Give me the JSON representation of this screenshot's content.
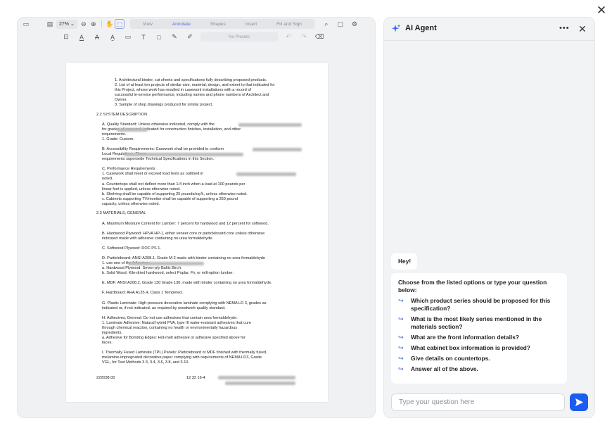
{
  "toolbar": {
    "zoom": "27%",
    "tabs": [
      "View",
      "Annotate",
      "Shapes",
      "Insert",
      "Fill and Sign"
    ],
    "active_tab": "Annotate",
    "presets_label": "No Presets"
  },
  "document": {
    "lines": [
      "1.      Architectural binder, cut sheets and specifications fully describing proposed products.",
      "2.      List of at least ten projects of similar size, material, design, and extent to that indicated for",
      "          this Project, whose work has resulted in casework installations with a record of",
      "          successful in-service performance, including names and phone numbers of Architect and",
      "          Owner.",
      "3.      Sample of shop drawings produced for similar project.",
      "2.2     SYSTEM DESCRIPTION",
      "A.      Quality Standard:  Unless otherwise indicated, comply with the",
      "          for grades of casework indicated for construction finishes, installation, and other",
      "          requirements.",
      "          1.      Grade: Custom.",
      "B.      Accessibility Requirements:  Casework shall be provided to conform",
      "                                                                              Local Regulations.  These",
      "          requirements supersede Technical Specifications in this Section.",
      "C.      Performance Requirements",
      "          1.      Casework shall meet or exceed load tests as outlined in",
      "                   noted.",
      "                   a.      Countertops shall not deflect more than 1/4 inch when a load at 100 pounds per",
      "                             linear foot is applied, unless otherwise noted.",
      "                   b.      Shelving shall be capable of supporting 25 pounds/sq.ft., unless otherwise noted.",
      "                   c.      Cabinets supporting TV/monitor shall be capable of supporting a 250 pound",
      "                             capacity, unless otherwise noted.",
      "2.3     MATERIALS, GENERAL",
      "A.      Maximum Moisture Content for Lumber:  7 percent for hardwood and 12 percent for softwood.",
      "B.      Hardwood Plywood:   HPVA HP-1, either veneer core or particleboard core unless otherwise",
      "          indicated made with adhesive containing no urea formaldehyde.",
      "C.      Softwood Plywood:  DOC PS 1.",
      "D.      Particleboard:  ANSI A208.1, Grade M-2 made with binder containing no urea formaldehyde",
      "          1.                                                          use one of the following:",
      "                   a.      Hardwood Plywood:  Seven-ply Baltic Birch.",
      "                   b.      Solid Wood:  Kiln-dried hardwood, select Poplar, Fir, or mill-option lumber.",
      "E.      MDF:  ANSI A208.2, Grade 130 Grade 130, made with binder containing no urea formaldehyde.",
      "F.      Hardboard:  AHA A135.4, Class 1 Tempered.",
      "G.      Plastic Laminate:   High-pressure decorative laminate complying with NEMA LD 3, grades as",
      "          indicated or, if not indicated, as required by woodwork quality standard.",
      "H.      Adhesives, General:  Do not use adhesives that contain urea formaldehyde.",
      "          1.      Laminate Adhesive:  Natural hybrid PVA, type III water-resistant adhesives that cure",
      "                   through  chemical  reaction,  containing  no  health  or  environmentally  hazardous",
      "                   ingredients.",
      "                   a.      Adhesive for Bonding Edges:  Hot-melt adhesive or adhesive specified above for",
      "                             faces.",
      "I.       Thermally Fused Laminate (TPL) Panels:  Particleboard or MDF finished with thermally fused,",
      "          melamine-impregnated decorative paper complying with requirements of NEMA LD3, Grade",
      "          VGL, for Test Methods 3.3, 3.4, 3.6, 3.8, and 3.10."
    ],
    "footer_left": "222038.00",
    "footer_center": "12 32 16-4"
  },
  "agent": {
    "title": "AI Agent",
    "greeting": "Hey!",
    "intro": "Choose from the listed options or type your question below:",
    "options": [
      "Which product series should be proposed for this specification?",
      "What is the most likely series mentioned in the materials section?",
      "What are the front information details?",
      "What cabinet box information is provided?",
      "Give details on countertops.",
      "Answer all of the above."
    ],
    "input_placeholder": "Type your question here"
  }
}
